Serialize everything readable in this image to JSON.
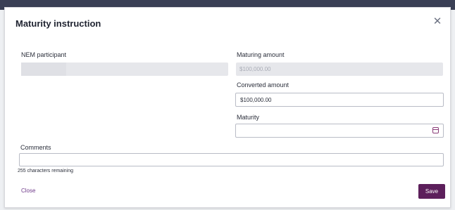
{
  "dialog": {
    "title": "Maturity instruction",
    "close_icon": "close-icon"
  },
  "fields": {
    "nem_participant": {
      "label": "NEM participant",
      "value": ""
    },
    "maturing_amount": {
      "label": "Maturing amount",
      "value": "$100,000.00"
    },
    "converted_amount": {
      "label": "Converted amount",
      "value": "$100,000.00"
    },
    "maturity": {
      "label": "Maturity",
      "value": "",
      "icon": "calendar-icon"
    },
    "comments": {
      "label": "Comments",
      "value": "",
      "helper": "255 characters remaining"
    }
  },
  "actions": {
    "close_label": "Close",
    "save_label": "Save"
  },
  "colors": {
    "accent": "#5c1f5b",
    "link": "#6f3a8a"
  }
}
